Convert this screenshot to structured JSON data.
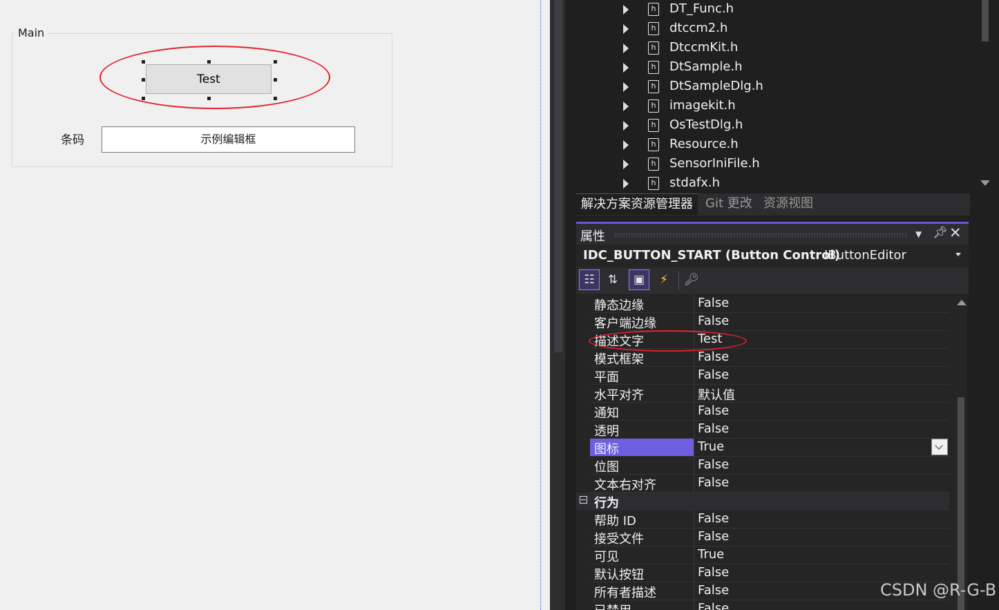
{
  "designer": {
    "group_title": "Main",
    "test_button_label": "Test",
    "barcode_label": "条码",
    "edit_box_text": "示例编辑框"
  },
  "solution_explorer": {
    "files": [
      "DT_Func.h",
      "dtccm2.h",
      "DtccmKit.h",
      "DtSample.h",
      "DtSampleDlg.h",
      "imagekit.h",
      "OsTestDlg.h",
      "Resource.h",
      "SensorIniFile.h",
      "stdafx.h"
    ],
    "file_icon_glyph": "h",
    "tabs": [
      "解决方案资源管理器",
      "Git 更改",
      "资源视图"
    ]
  },
  "properties": {
    "title": "属性",
    "object_name": "IDC_BUTTON_START (Button Control)",
    "object_type": "IButtonEditor",
    "toolbar": [
      "categorized-icon",
      "alphabetical-icon",
      "properties-icon",
      "events-icon",
      "property-pages-icon"
    ],
    "rows_appearance": [
      {
        "name": "静态边缘",
        "value": "False"
      },
      {
        "name": "客户端边缘",
        "value": "False"
      },
      {
        "name": "描述文字",
        "value": "Test"
      },
      {
        "name": "模式框架",
        "value": "False"
      },
      {
        "name": "平面",
        "value": "False"
      },
      {
        "name": "水平对齐",
        "value": "默认值"
      },
      {
        "name": "通知",
        "value": "False"
      },
      {
        "name": "透明",
        "value": "False"
      },
      {
        "name": "图标",
        "value": "True"
      },
      {
        "name": "位图",
        "value": "False"
      },
      {
        "name": "文本右对齐",
        "value": "False"
      }
    ],
    "category_behavior": "行为",
    "rows_behavior": [
      {
        "name": "帮助 ID",
        "value": "False"
      },
      {
        "name": "接受文件",
        "value": "False"
      },
      {
        "name": "可见",
        "value": "True"
      },
      {
        "name": "默认按钮",
        "value": "False"
      },
      {
        "name": "所有者描述",
        "value": "False"
      },
      {
        "name": "已禁用",
        "value": "False"
      }
    ],
    "selected_row": "图标"
  },
  "colors": {
    "annotation_red": "#e0222a",
    "selection_purple": "#6e5fe0",
    "ide_background": "#1f1f1f"
  },
  "watermark": "CSDN @R-G-B"
}
